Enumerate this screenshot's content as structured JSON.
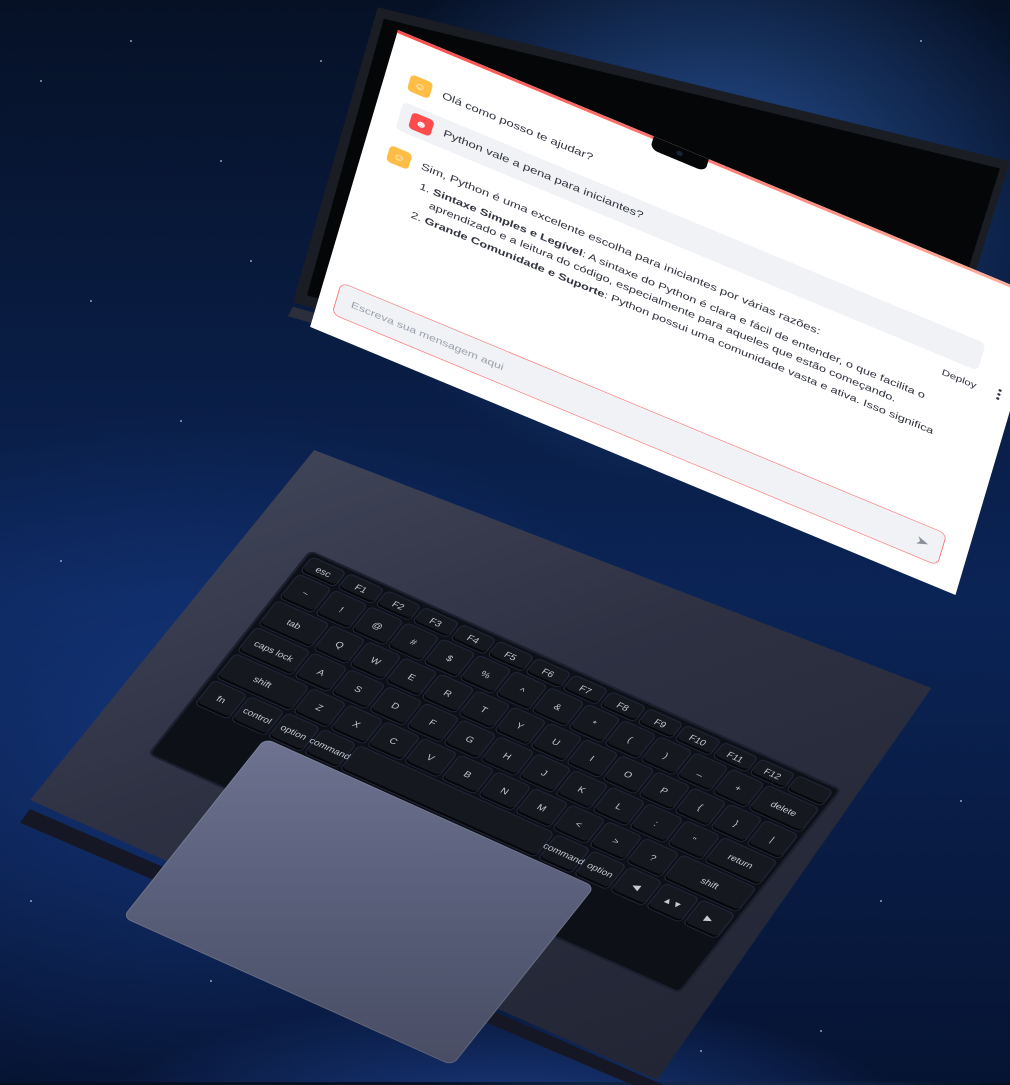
{
  "app": {
    "deploy_label": "Deploy"
  },
  "chat": {
    "messages": [
      {
        "role": "assistant",
        "text": "Olá como posso te ajudar?"
      },
      {
        "role": "user",
        "text": "Python vale a pena para iniciantes?"
      },
      {
        "role": "assistant",
        "text": "Sim, Python é uma excelente escolha para iniciantes por várias razões:",
        "list": [
          {
            "title": "Sintaxe Simples e Legível",
            "body": ": A sintaxe do Python é clara e fácil de entender, o que facilita o aprendizado e a leitura do código, especialmente para aqueles que estão começando."
          },
          {
            "title": "Grande Comunidade e Suporte",
            "body": ": Python possui uma comunidade vasta e ativa. Isso significa"
          }
        ]
      }
    ],
    "input_placeholder": "Escreva sua mensagem aqui"
  },
  "icons": {
    "assistant_avatar": "bot-icon",
    "user_avatar": "user-icon",
    "send": "send-arrow-icon",
    "menu": "kebab-menu-icon"
  },
  "colors": {
    "accent": "#ff4b4b",
    "assistant_avatar_bg": "#ffbd45",
    "user_bubble_bg": "#f0f2f6",
    "text": "#31333f"
  },
  "keyboard": {
    "rows": [
      [
        "esc",
        "F1",
        "F2",
        "F3",
        "F4",
        "F5",
        "F6",
        "F7",
        "F8",
        "F9",
        "F10",
        "F11",
        "F12",
        ""
      ],
      [
        "~",
        "!",
        "@",
        "#",
        "$",
        "%",
        "^",
        "&",
        "*",
        "(",
        ")",
        "_",
        "+",
        "delete"
      ],
      [
        "tab",
        "Q",
        "W",
        "E",
        "R",
        "T",
        "Y",
        "U",
        "I",
        "O",
        "P",
        "{",
        "}",
        "|"
      ],
      [
        "caps lock",
        "A",
        "S",
        "D",
        "F",
        "G",
        "H",
        "J",
        "K",
        "L",
        ":",
        "\"",
        "return"
      ],
      [
        "shift",
        "Z",
        "X",
        "C",
        "V",
        "B",
        "N",
        "M",
        "<",
        ">",
        "?",
        "shift"
      ],
      [
        "fn",
        "control",
        "option",
        "command",
        "",
        "command",
        "option",
        "◀",
        "▲▼",
        "▶"
      ]
    ]
  }
}
